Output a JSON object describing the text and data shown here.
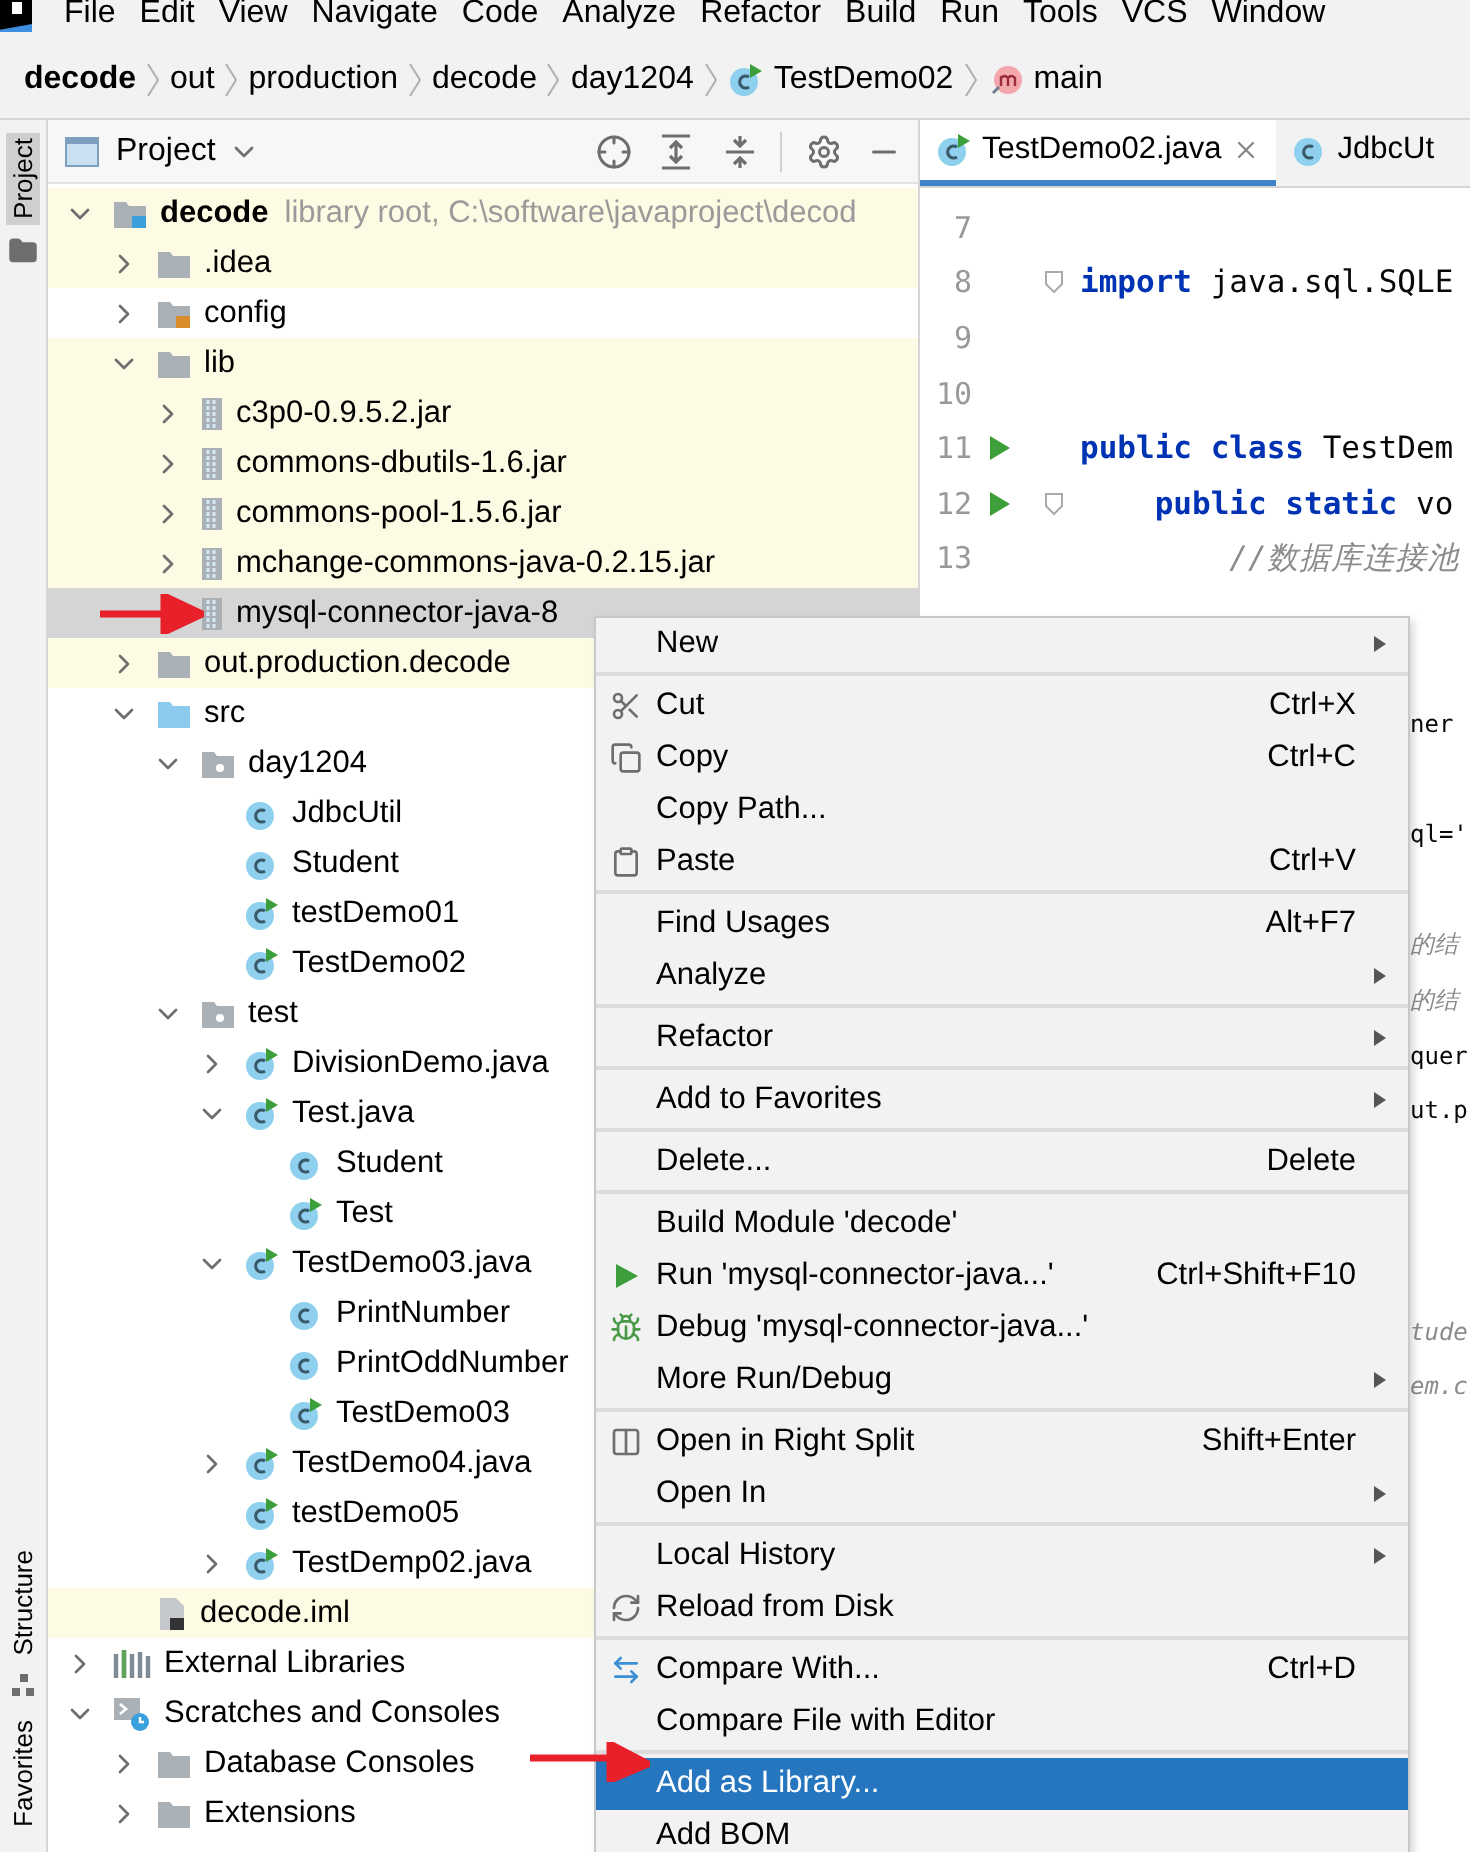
{
  "menu_bar": {
    "items": [
      "File",
      "Edit",
      "View",
      "Navigate",
      "Code",
      "Analyze",
      "Refactor",
      "Build",
      "Run",
      "Tools",
      "VCS",
      "Window"
    ]
  },
  "breadcrumbs": [
    {
      "label": "decode",
      "kind": "project"
    },
    {
      "label": "out",
      "kind": "folder"
    },
    {
      "label": "production",
      "kind": "folder"
    },
    {
      "label": "decode",
      "kind": "folder"
    },
    {
      "label": "day1204",
      "kind": "folder"
    },
    {
      "label": "TestDemo02",
      "kind": "class"
    },
    {
      "label": "main",
      "kind": "method"
    }
  ],
  "tool_strip": [
    {
      "label": "Project",
      "selected": true
    },
    {
      "label": "Structure",
      "selected": false
    },
    {
      "label": "Favorites",
      "selected": false
    }
  ],
  "project": {
    "title": "Project",
    "tree": [
      {
        "label": "decode",
        "hint": "library root,  C:\\software\\javaproject\\decod",
        "kind": "module",
        "expanded": true,
        "highlighted": true,
        "selected": false,
        "children": [
          {
            "label": ".idea",
            "kind": "folder",
            "expanded": false,
            "highlighted": true,
            "selected": false
          },
          {
            "label": "config",
            "kind": "resources",
            "expanded": false,
            "highlighted": false,
            "selected": false
          },
          {
            "label": "lib",
            "kind": "folder",
            "expanded": true,
            "highlighted": true,
            "selected": false,
            "children": [
              {
                "label": "c3p0-0.9.5.2.jar",
                "kind": "jar",
                "expanded": false,
                "highlighted": true,
                "selected": false
              },
              {
                "label": "commons-dbutils-1.6.jar",
                "kind": "jar",
                "expanded": false,
                "highlighted": true,
                "selected": false
              },
              {
                "label": "commons-pool-1.5.6.jar",
                "kind": "jar",
                "expanded": false,
                "highlighted": true,
                "selected": false
              },
              {
                "label": "mchange-commons-java-0.2.15.jar",
                "kind": "jar",
                "expanded": false,
                "highlighted": true,
                "selected": false
              },
              {
                "label": "mysql-connector-java-8",
                "kind": "jar",
                "highlighted": true,
                "selected": true
              }
            ]
          },
          {
            "label": "out.production.decode",
            "kind": "folder",
            "expanded": false,
            "highlighted": true,
            "selected": false
          },
          {
            "label": "src",
            "kind": "source",
            "expanded": true,
            "highlighted": false,
            "selected": false,
            "children": [
              {
                "label": "day1204",
                "kind": "package",
                "expanded": true,
                "highlighted": false,
                "selected": false,
                "children": [
                  {
                    "label": "JdbcUtil",
                    "kind": "class",
                    "highlighted": false,
                    "selected": false
                  },
                  {
                    "label": "Student",
                    "kind": "class",
                    "highlighted": false,
                    "selected": false
                  },
                  {
                    "label": "testDemo01",
                    "kind": "runnable",
                    "highlighted": false,
                    "selected": false
                  },
                  {
                    "label": "TestDemo02",
                    "kind": "runnable",
                    "highlighted": false,
                    "selected": false
                  }
                ]
              },
              {
                "label": "test",
                "kind": "package",
                "expanded": true,
                "highlighted": false,
                "selected": false,
                "children": [
                  {
                    "label": "DivisionDemo.java",
                    "kind": "runnable",
                    "expanded": false,
                    "highlighted": false,
                    "selected": false
                  },
                  {
                    "label": "Test.java",
                    "kind": "runnable",
                    "expanded": true,
                    "highlighted": false,
                    "selected": false,
                    "children": [
                      {
                        "label": "Student",
                        "kind": "class",
                        "highlighted": false,
                        "selected": false
                      },
                      {
                        "label": "Test",
                        "kind": "runnable",
                        "highlighted": false,
                        "selected": false
                      }
                    ]
                  },
                  {
                    "label": "TestDemo03.java",
                    "kind": "runnable",
                    "expanded": true,
                    "highlighted": false,
                    "selected": false,
                    "children": [
                      {
                        "label": "PrintNumber",
                        "kind": "class",
                        "highlighted": false,
                        "selected": false
                      },
                      {
                        "label": "PrintOddNumber",
                        "kind": "class",
                        "highlighted": false,
                        "selected": false
                      },
                      {
                        "label": "TestDemo03",
                        "kind": "runnable",
                        "highlighted": false,
                        "selected": false
                      }
                    ]
                  },
                  {
                    "label": "TestDemo04.java",
                    "kind": "runnable",
                    "expanded": false,
                    "highlighted": false,
                    "selected": false
                  },
                  {
                    "label": "testDemo05",
                    "kind": "runnable",
                    "highlighted": false,
                    "selected": false
                  },
                  {
                    "label": "TestDemp02.java",
                    "kind": "runnable",
                    "expanded": false,
                    "highlighted": false,
                    "selected": false
                  }
                ]
              }
            ]
          },
          {
            "label": "decode.iml",
            "kind": "iml",
            "highlighted": true,
            "selected": false
          }
        ]
      },
      {
        "label": "External Libraries",
        "kind": "libraries",
        "expanded": false,
        "highlighted": false,
        "selected": false
      },
      {
        "label": "Scratches and Consoles",
        "kind": "scratches",
        "expanded": true,
        "highlighted": false,
        "selected": false,
        "children": [
          {
            "label": "Database Consoles",
            "kind": "folder",
            "expanded": false,
            "highlighted": false,
            "selected": false
          },
          {
            "label": "Extensions",
            "kind": "folder",
            "expanded": false,
            "highlighted": false,
            "selected": false
          }
        ]
      }
    ]
  },
  "editor": {
    "tabs": [
      {
        "label": "TestDemo02.java",
        "selected": true
      },
      {
        "label": "JdbcUt",
        "selected": false
      }
    ],
    "lines": [
      {
        "number": "7",
        "kind": "blank"
      },
      {
        "number": "8",
        "kind": "code",
        "text": "**import** java.sql.SQLE",
        "fold": true
      },
      {
        "number": "9",
        "kind": "blank"
      },
      {
        "number": "10",
        "kind": "blank"
      },
      {
        "number": "11",
        "kind": "code",
        "text": "**public class** TestDem",
        "run": true
      },
      {
        "number": "12",
        "kind": "code",
        "text": "    **public static** vo",
        "run": true,
        "fold": true
      },
      {
        "number": "13",
        "kind": "comment",
        "text": "        //数据库连接池"
      },
      {
        "kind": "blank"
      },
      {
        "kind": "blank"
      },
      {
        "kind": "code",
        "text": "ner"
      },
      {
        "kind": "blank"
      },
      {
        "kind": "code",
        "text": "ql='"
      },
      {
        "kind": "blank"
      },
      {
        "kind": "comment",
        "text": "的结"
      },
      {
        "kind": "comment",
        "text": "的结"
      },
      {
        "kind": "code",
        "text": "quer"
      },
      {
        "kind": "code",
        "text": "ut.p"
      },
      {
        "kind": "blank"
      },
      {
        "kind": "blank"
      },
      {
        "kind": "blank"
      },
      {
        "kind": "comment",
        "text": "tude"
      },
      {
        "kind": "comment",
        "text": "em.c"
      }
    ]
  },
  "context_menu": {
    "groups": [
      [
        {
          "label": "New",
          "submenu": true,
          "selected": false
        }
      ],
      [
        {
          "label": "Cut",
          "kind": "cut",
          "shortcut": "Ctrl+X",
          "submenu": false,
          "selected": false
        },
        {
          "label": "Copy",
          "kind": "copy",
          "shortcut": "Ctrl+C",
          "submenu": false,
          "selected": false
        },
        {
          "label": "Copy Path...",
          "submenu": false,
          "selected": false
        },
        {
          "label": "Paste",
          "kind": "paste",
          "shortcut": "Ctrl+V",
          "submenu": false,
          "selected": false
        }
      ],
      [
        {
          "label": "Find Usages",
          "shortcut": "Alt+F7",
          "submenu": false,
          "selected": false
        },
        {
          "label": "Analyze",
          "submenu": true,
          "selected": false
        }
      ],
      [
        {
          "label": "Refactor",
          "submenu": true,
          "selected": false
        }
      ],
      [
        {
          "label": "Add to Favorites",
          "submenu": true,
          "selected": false
        }
      ],
      [
        {
          "label": "Delete...",
          "shortcut": "Delete",
          "submenu": false,
          "selected": false
        }
      ],
      [
        {
          "label": "Build Module 'decode'",
          "submenu": false,
          "selected": false
        },
        {
          "label": "Run 'mysql-connector-java...'",
          "kind": "run",
          "shortcut": "Ctrl+Shift+F10",
          "submenu": false,
          "selected": false
        },
        {
          "label": "Debug 'mysql-connector-java...'",
          "kind": "debug",
          "submenu": false,
          "selected": false
        },
        {
          "label": "More Run/Debug",
          "submenu": true,
          "selected": false
        }
      ],
      [
        {
          "label": "Open in Right Split",
          "kind": "split",
          "shortcut": "Shift+Enter",
          "submenu": false,
          "selected": false
        },
        {
          "label": "Open In",
          "submenu": true,
          "selected": false
        }
      ],
      [
        {
          "label": "Local History",
          "submenu": true,
          "selected": false
        },
        {
          "label": "Reload from Disk",
          "kind": "reload",
          "submenu": false,
          "selected": false
        }
      ],
      [
        {
          "label": "Compare With...",
          "kind": "compare",
          "shortcut": "Ctrl+D",
          "submenu": false,
          "selected": false
        },
        {
          "label": "Compare File with Editor",
          "submenu": false,
          "selected": false
        }
      ],
      [
        {
          "label": "Add as Library...",
          "submenu": false,
          "selected": true
        },
        {
          "label": "Add BOM",
          "submenu": false,
          "selected": false
        }
      ]
    ]
  }
}
